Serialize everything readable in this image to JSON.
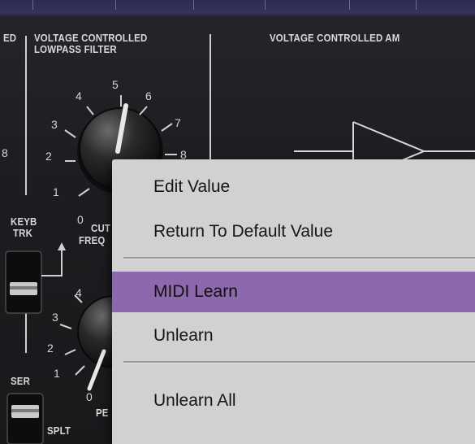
{
  "panel": {
    "section_left_partial": "ED",
    "section_filter_line1": "VOLTAGE CONTROLLED",
    "section_filter_line2": "LOWPASS FILTER",
    "section_amp": "VOLTAGE CONTROLLED AM",
    "keyb_line1": "KEYB",
    "keyb_line2": "TRK",
    "cutoff_line1": "CUT",
    "cutoff_line2": "FREQ",
    "ser_label": "SER",
    "splt_label": "SPLT",
    "partial_label": "PE",
    "left_edge_num": "8",
    "knob1_scale": [
      "0",
      "1",
      "2",
      "3",
      "4",
      "5",
      "6",
      "7",
      "8"
    ],
    "knob2_scale": [
      "0",
      "1",
      "2",
      "3",
      "4"
    ]
  },
  "context_menu": {
    "items": [
      {
        "label": "Edit Value",
        "selected": false
      },
      {
        "label": "Return To Default Value",
        "selected": false
      },
      {
        "label": "MIDI Learn",
        "selected": true
      },
      {
        "label": "Unlearn",
        "selected": false
      },
      {
        "label": "Unlearn All",
        "selected": false
      }
    ],
    "highlight_color": "#8d68ac",
    "background_color": "#d2d1d1"
  }
}
